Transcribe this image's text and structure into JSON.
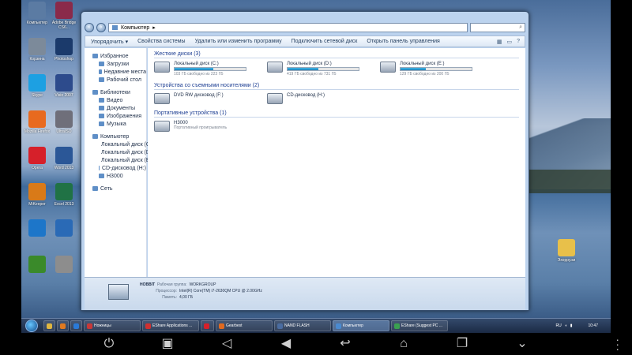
{
  "desktop": {
    "left_icons": [
      {
        "label": "Компьютер",
        "icon": "computer-icon",
        "color": "#5b7ba3"
      },
      {
        "label": "Adobe Bridge CS6...",
        "icon": "adobe-icon",
        "color": "#8a2a4a"
      },
      {
        "label": "Корзина",
        "icon": "recycle-bin-icon",
        "color": "#7c8a9a"
      },
      {
        "label": "Photoshop",
        "icon": "photoshop-icon",
        "color": "#1b3a6b"
      },
      {
        "label": "Skype",
        "icon": "skype-icon",
        "color": "#1da0e2"
      },
      {
        "label": "Visio 2007",
        "icon": "visio-icon",
        "color": "#2d4b8c"
      },
      {
        "label": "Mozilla Firefox",
        "icon": "firefox-icon",
        "color": "#e86a1f"
      },
      {
        "label": "UltraISO",
        "icon": "ultraiso-icon",
        "color": "#6f6f7a"
      },
      {
        "label": "Opera",
        "icon": "opera-icon",
        "color": "#d6202a"
      },
      {
        "label": "Word 2013",
        "icon": "word-icon",
        "color": "#2b5797"
      },
      {
        "label": "MiKeeper",
        "icon": "app-icon",
        "color": "#d97a18"
      },
      {
        "label": "Excel 2013",
        "icon": "excel-icon",
        "color": "#207245"
      },
      {
        "label": "",
        "icon": "app-icon",
        "color": "#1d76c9"
      },
      {
        "label": "",
        "icon": "teamviewer-icon",
        "color": "#2a6ab6"
      },
      {
        "label": "",
        "icon": "utorrent-icon",
        "color": "#3a8a2a"
      },
      {
        "label": "",
        "icon": "app-icon",
        "color": "#8d8d8d"
      }
    ],
    "right_folder": {
      "label": "Эхорру.ки",
      "icon": "folder-icon"
    }
  },
  "window": {
    "breadcrumb": [
      "Компьютер"
    ],
    "search_icon": "search-icon",
    "commands": [
      "Упорядочить ▾",
      "Свойства системы",
      "Удалить или изменить программу",
      "Подключить сетевой диск",
      "Открыть панель управления"
    ],
    "nav": [
      {
        "label": "Избранное",
        "level": 0,
        "gap": false
      },
      {
        "label": "Загрузки",
        "level": 1,
        "gap": false
      },
      {
        "label": "Недавние места",
        "level": 1,
        "gap": false
      },
      {
        "label": "Рабочий стол",
        "level": 1,
        "gap": false
      },
      {
        "label": "Библиотеки",
        "level": 0,
        "gap": true
      },
      {
        "label": "Видео",
        "level": 1,
        "gap": false
      },
      {
        "label": "Документы",
        "level": 1,
        "gap": false
      },
      {
        "label": "Изображения",
        "level": 1,
        "gap": false
      },
      {
        "label": "Музыка",
        "level": 1,
        "gap": false
      },
      {
        "label": "Компьютер",
        "level": 0,
        "gap": true
      },
      {
        "label": "Локальный диск (C:)",
        "level": 1,
        "gap": false
      },
      {
        "label": "Локальный диск (D:)",
        "level": 1,
        "gap": false
      },
      {
        "label": "Локальный диск (E:)",
        "level": 1,
        "gap": false
      },
      {
        "label": "CD-дисковод (H:)",
        "level": 1,
        "gap": false
      },
      {
        "label": "H3000",
        "level": 1,
        "gap": false
      },
      {
        "label": "Сеть",
        "level": 0,
        "gap": true
      }
    ],
    "groups": {
      "hdd": {
        "title": "Жесткие диски (3)",
        "items": [
          {
            "name": "Локальный диск (C:)",
            "free": "103 ГБ свободно из 223 ГБ",
            "used_fraction": 0.54
          },
          {
            "name": "Локальный диск (D:)",
            "free": "419 ГБ свободно из 731 ГБ",
            "used_fraction": 0.43
          },
          {
            "name": "Локальный диск (E:)",
            "free": "129 ГБ свободно из 200 ГБ",
            "used_fraction": 0.36
          }
        ]
      },
      "removable": {
        "title": "Устройства со съемными носителями (2)",
        "items": [
          {
            "name": "DVD RW дисковод (F:)"
          },
          {
            "name": "CD-дисковод (H:)"
          }
        ]
      },
      "portable": {
        "title": "Портативные устройства (1)",
        "items": [
          {
            "name": "H3000",
            "sub": "Портативный проигрыватель"
          }
        ]
      }
    },
    "details": {
      "name": "HOBBIT",
      "workgroup_label": "Рабочая группа:",
      "workgroup": "WORKGROUP",
      "cpu_label": "Процессор:",
      "cpu": "Intel(R) Core(TM) i7-2630QM CPU @ 2.00GHz",
      "ram_label": "Память:",
      "ram": "4,00 ГБ"
    }
  },
  "taskbar": {
    "pinned": [
      {
        "icon": "explorer-icon",
        "color": "#e0b640"
      },
      {
        "icon": "media-player-icon",
        "color": "#e07a20"
      },
      {
        "icon": "ie-icon",
        "color": "#2a7ad8"
      }
    ],
    "tasks": [
      {
        "label": "Ножницы",
        "icon": "scissors-icon",
        "color": "#c83838",
        "active": false
      },
      {
        "label": "EShare Applications ...",
        "icon": "eshare-icon",
        "color": "#d03030",
        "active": false
      },
      {
        "label": "",
        "icon": "opera-icon",
        "color": "#d6202a",
        "active": false
      },
      {
        "label": "Gearbest",
        "icon": "web-icon",
        "color": "#e06a20",
        "active": false
      },
      {
        "label": "NAND FLASH",
        "icon": "app-icon",
        "color": "#4a6ca0",
        "active": false
      },
      {
        "label": "Компьютер",
        "icon": "explorer-icon",
        "color": "#4a8ad0",
        "active": true
      },
      {
        "label": "EShare (Suggest PC ...",
        "icon": "eshare-icon",
        "color": "#3aa050",
        "active": false
      }
    ],
    "lang": "RU",
    "time": "10:47"
  },
  "android_nav": [
    "power-icon",
    "screenshot-icon",
    "volume-down-icon",
    "volume-up-icon",
    "back-icon",
    "home-icon",
    "recent-apps-icon",
    "collapse-icon"
  ]
}
